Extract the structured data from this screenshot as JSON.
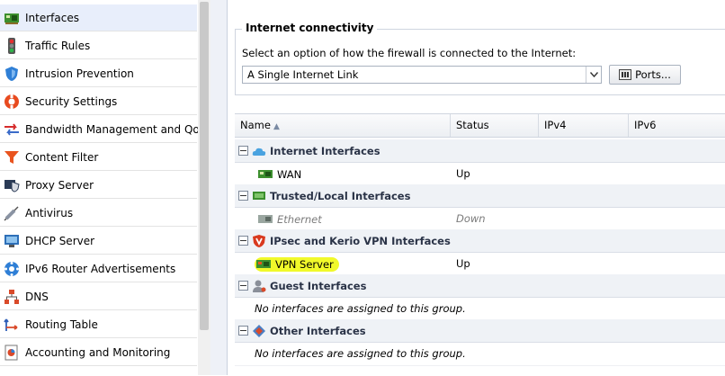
{
  "sidebar": {
    "items": [
      {
        "label": "Interfaces",
        "icon": "network-card-icon",
        "selected": true
      },
      {
        "label": "Traffic Rules",
        "icon": "traffic-light-icon"
      },
      {
        "label": "Intrusion Prevention",
        "icon": "shield-icon"
      },
      {
        "label": "Security Settings",
        "icon": "lifebuoy-icon"
      },
      {
        "label": "Bandwidth Management and QoS",
        "icon": "bandwidth-arrows-icon"
      },
      {
        "label": "Content Filter",
        "icon": "funnel-icon"
      },
      {
        "label": "Proxy Server",
        "icon": "proxy-icon"
      },
      {
        "label": "Antivirus",
        "icon": "syringe-icon"
      },
      {
        "label": "DHCP Server",
        "icon": "monitor-icon"
      },
      {
        "label": "IPv6 Router Advertisements",
        "icon": "ipv6-gear-icon"
      },
      {
        "label": "DNS",
        "icon": "dns-tree-icon"
      },
      {
        "label": "Routing Table",
        "icon": "routing-icon"
      },
      {
        "label": "Accounting and Monitoring",
        "icon": "chart-icon"
      }
    ]
  },
  "connectivity": {
    "legend": "Internet connectivity",
    "prompt": "Select an option of how the firewall is connected to the Internet:",
    "selected_option": "A Single Internet Link",
    "ports_label": "Ports..."
  },
  "grid": {
    "columns": [
      "Name",
      "Status",
      "IPv4",
      "IPv6"
    ],
    "groups": [
      {
        "label": "Internet Interfaces",
        "icon": "cloud-icon",
        "rows": [
          {
            "name": "WAN",
            "status": "Up"
          }
        ]
      },
      {
        "label": "Trusted/Local Interfaces",
        "icon": "trusted-network-icon",
        "rows": [
          {
            "name": "Ethernet",
            "status": "Down",
            "disabled": true
          }
        ]
      },
      {
        "label": "IPsec and Kerio VPN Interfaces",
        "icon": "vpn-shield-icon",
        "rows": [
          {
            "name": "VPN Server",
            "status": "Up",
            "highlighted": true
          }
        ]
      },
      {
        "label": "Guest Interfaces",
        "icon": "guest-user-icon",
        "empty": "No interfaces are assigned to this group."
      },
      {
        "label": "Other Interfaces",
        "icon": "other-diamond-icon",
        "empty": "No interfaces are assigned to this group."
      }
    ]
  },
  "colors": {
    "highlight": "#f1f92a",
    "selected_item": "#e8eefb",
    "group_bg": "#eff2f6"
  }
}
